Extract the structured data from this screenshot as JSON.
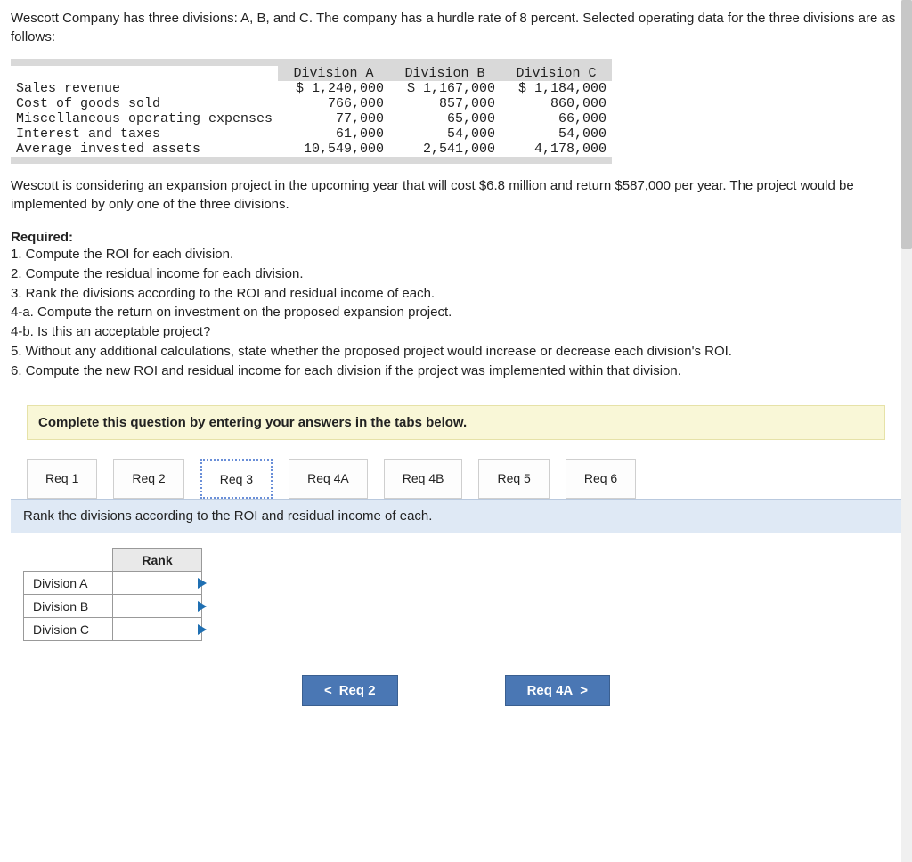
{
  "intro": "Wescott Company has three divisions: A, B, and C. The company has a hurdle rate of 8 percent. Selected operating data for the three divisions are as follows:",
  "data_table": {
    "col_headers": [
      "Division A",
      "Division B",
      "Division C"
    ],
    "rows": [
      {
        "label": "Sales revenue",
        "a": "$ 1,240,000",
        "b": "$ 1,167,000",
        "c": "$ 1,184,000"
      },
      {
        "label": "Cost of goods sold",
        "a": "766,000",
        "b": "857,000",
        "c": "860,000"
      },
      {
        "label": "Miscellaneous operating expenses",
        "a": "77,000",
        "b": "65,000",
        "c": "66,000"
      },
      {
        "label": "Interest and taxes",
        "a": "61,000",
        "b": "54,000",
        "c": "54,000"
      },
      {
        "label": "Average invested assets",
        "a": "10,549,000",
        "b": "2,541,000",
        "c": "4,178,000"
      }
    ]
  },
  "expansion_para": "Wescott is considering an expansion project in the upcoming year that will cost $6.8 million and return $587,000 per year. The project would be implemented by only one of the three divisions.",
  "required": {
    "header": "Required:",
    "items": [
      "1. Compute the ROI for each division.",
      "2. Compute the residual income for each division.",
      "3. Rank the divisions according to the ROI and residual income of each.",
      "4-a. Compute the return on investment on the proposed expansion project.",
      "4-b. Is this an acceptable project?",
      "5. Without any additional calculations, state whether the proposed project would increase or decrease each division's ROI.",
      "6. Compute the new ROI and residual income for each division if the project was implemented within that division."
    ]
  },
  "complete_msg": "Complete this question by entering your answers in the tabs below.",
  "tabs": [
    "Req 1",
    "Req 2",
    "Req 3",
    "Req 4A",
    "Req 4B",
    "Req 5",
    "Req 6"
  ],
  "active_tab_instruction": "Rank the divisions according to the ROI and residual income of each.",
  "rank_table": {
    "col_header": "Rank",
    "rows": [
      "Division A",
      "Division B",
      "Division C"
    ]
  },
  "nav": {
    "prev": "Req 2",
    "next": "Req 4A"
  }
}
